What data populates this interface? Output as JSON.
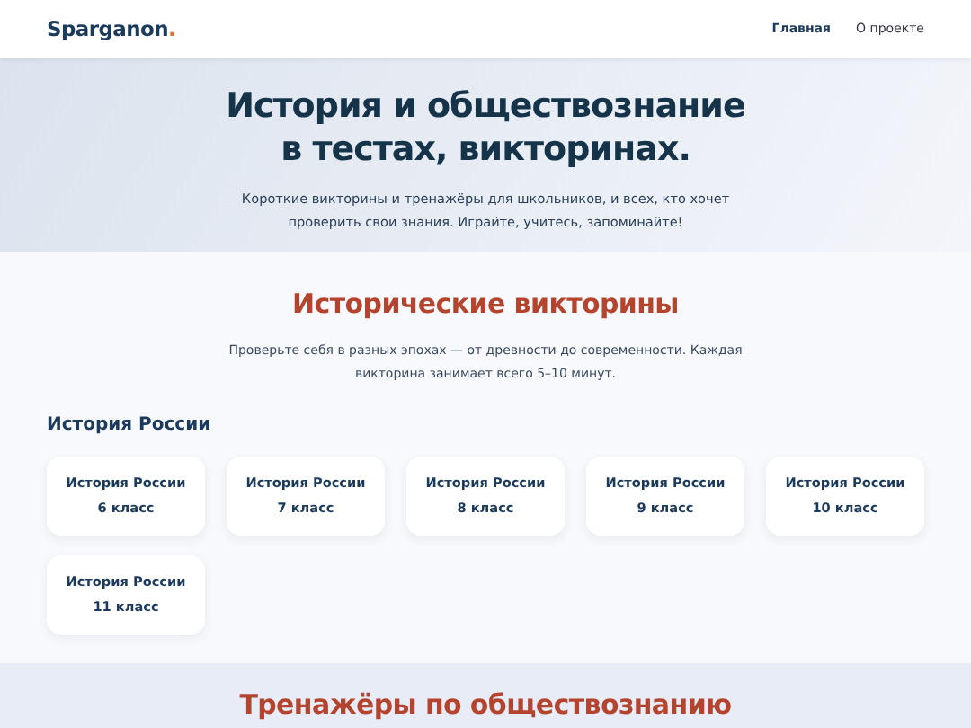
{
  "header": {
    "logo": "Sparganon",
    "logo_dot": ".",
    "nav": [
      {
        "label": "Главная",
        "selected": true
      },
      {
        "label": "О проекте",
        "selected": false
      }
    ]
  },
  "hero": {
    "title_lines": [
      "История и обществознание",
      "в тестах, викторинах."
    ],
    "subtitle": "Короткие викторины и тренажёры для школьников, и всех, кто хочет проверить свои знания. Играйте, учитесь, запоминайте!"
  },
  "quizzes": {
    "title": "Исторические викторины",
    "description": "Проверьте себя в разных эпохах — от древности до современности. Каждая викторина занимает всего 5–10 минут.",
    "group": "История России",
    "cards": [
      {
        "title": "История России",
        "grade": "6 класс"
      },
      {
        "title": "История России",
        "grade": "7 класс"
      },
      {
        "title": "История России",
        "grade": "8 класс"
      },
      {
        "title": "История России",
        "grade": "9 класс"
      },
      {
        "title": "История России",
        "grade": "10 класс"
      },
      {
        "title": "История России",
        "grade": "11 класс"
      }
    ]
  },
  "trainers": {
    "title": "Тренажёры по обществознанию"
  }
}
